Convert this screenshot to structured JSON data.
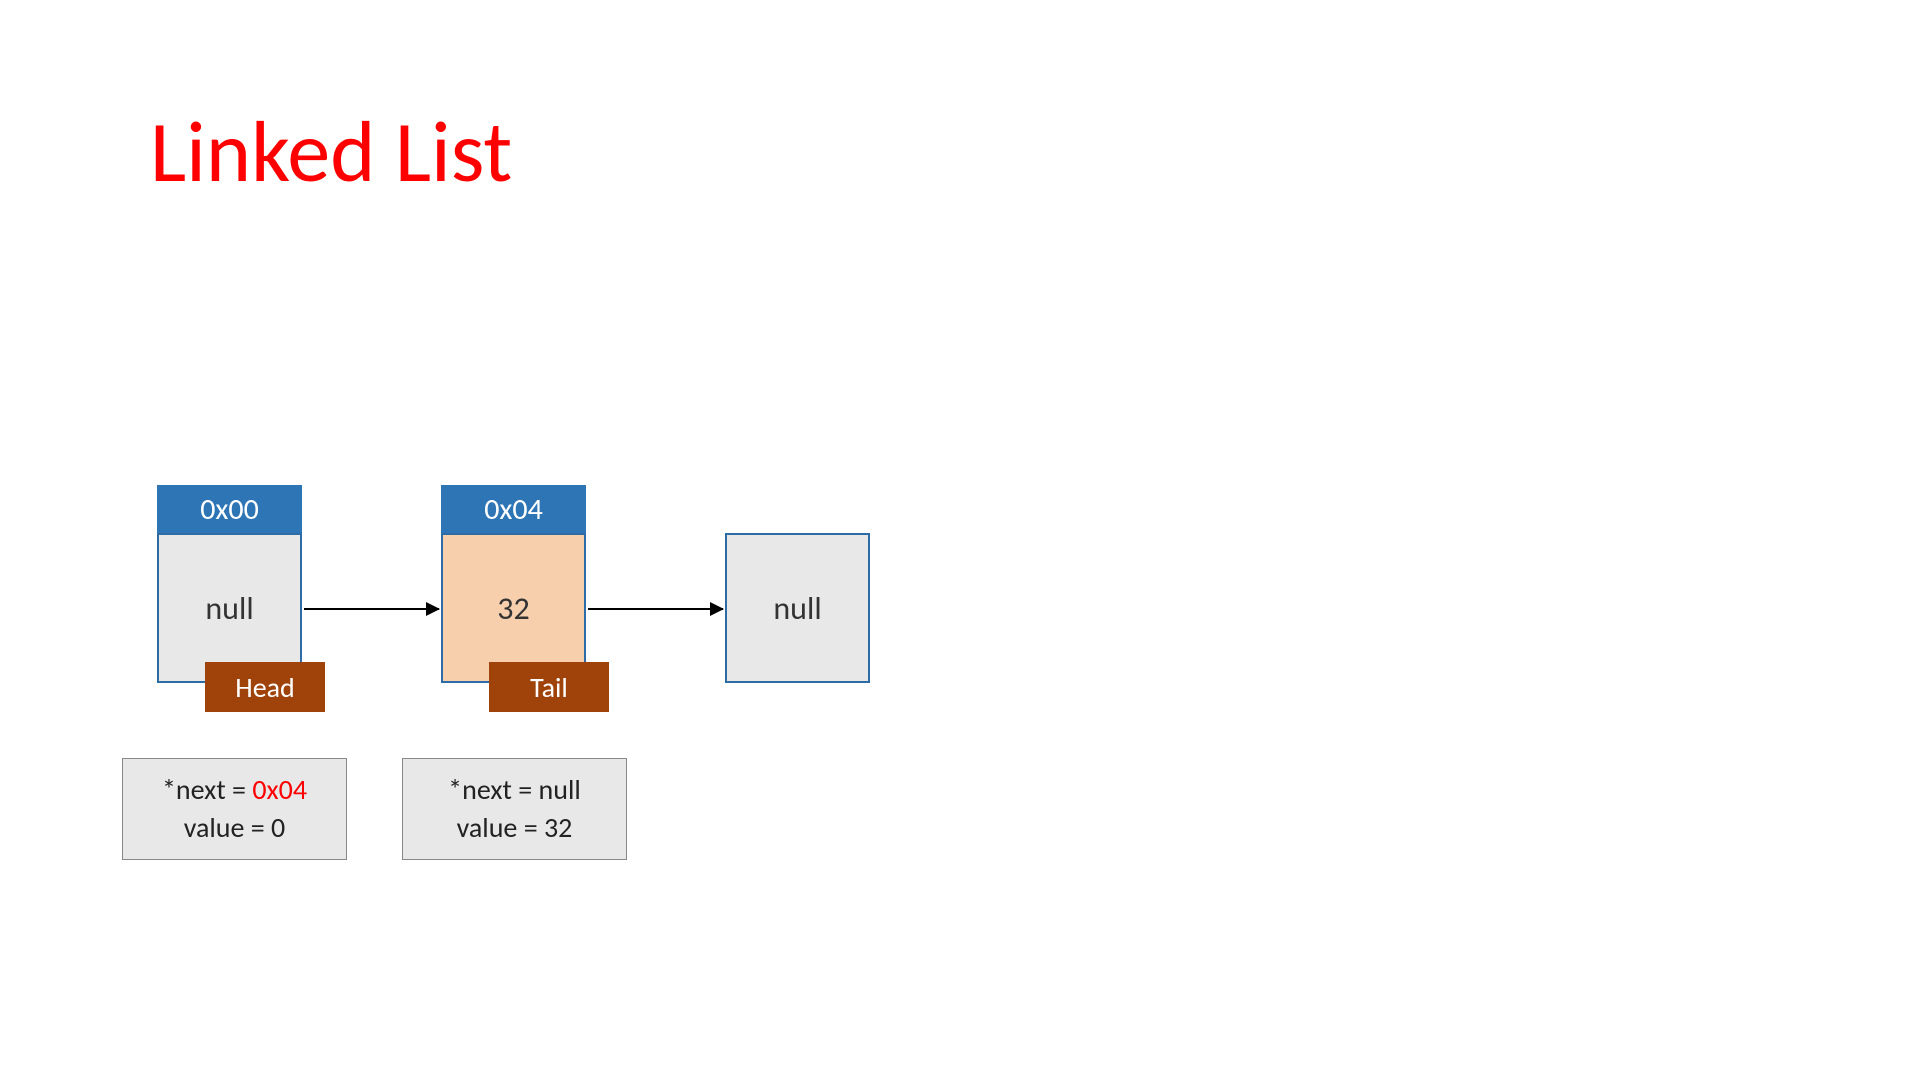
{
  "title": "Linked List",
  "nodes": [
    {
      "addr": "0x00",
      "value": "null",
      "role": "Head"
    },
    {
      "addr": "0x04",
      "value": "32",
      "role": "Tail"
    },
    {
      "addr": "",
      "value": "null",
      "role": ""
    }
  ],
  "info": {
    "head": {
      "next_prefix": "*next = ",
      "next_value": "0x04",
      "value_line": "value = 0"
    },
    "tail": {
      "line1": "*next = null",
      "line2": "value = 32"
    }
  }
}
